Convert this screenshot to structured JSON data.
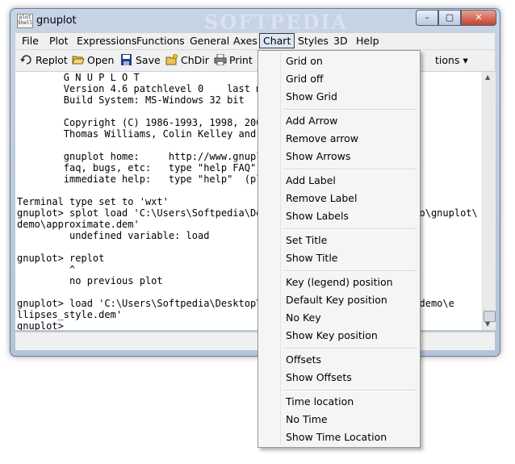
{
  "window": {
    "title": "gnuplot",
    "app_icon_text": "plot Shell",
    "watermark": "SOFTPEDIA",
    "buttons": {
      "minimize": "–",
      "maximize": "▢",
      "close": "✕"
    }
  },
  "menubar": [
    "File",
    "Plot",
    "Expressions",
    "Functions",
    "General",
    "Axes",
    "Chart",
    "Styles",
    "3D",
    "Help"
  ],
  "toolbar": {
    "replot": "Replot",
    "open": "Open",
    "save": "Save",
    "chdir": "ChDir",
    "print": "Print",
    "options_partial": "tions"
  },
  "console_lines": [
    "        G N U P L O T",
    "        Version 4.6 patchlevel 0    last mo",
    "        Build System: MS-Windows 32 bit",
    "",
    "        Copyright (C) 1986-1993, 1998, 2004",
    "        Thomas Williams, Colin Kelley and m",
    "",
    "        gnuplot home:     http://www.gnuplo",
    "        faq, bugs, etc:   type \"help FAQ\"",
    "        immediate help:   type \"help\"  (plo",
    "",
    "Terminal type set to 'wxt'",
    "gnuplot> splot load 'C:\\Users\\Softpedia\\Des                          o\\gnuplot\\",
    "demo\\approximate.dem'",
    "         undefined variable: load",
    "",
    "gnuplot> replot",
    "         ^",
    "         no previous plot",
    "",
    "gnuplot> load 'C:\\Users\\Softpedia\\Desktop\\X                       ot\\demo\\e",
    "llipses_style.dem'",
    "gnuplot>"
  ],
  "chart_menu": {
    "grid_on": "Grid on",
    "grid_off": "Grid off",
    "show_grid": "Show Grid",
    "add_arrow": "Add Arrow",
    "remove_arrow": "Remove arrow",
    "show_arrows": "Show Arrows",
    "add_label": "Add Label",
    "remove_label": "Remove Label",
    "show_labels": "Show Labels",
    "set_title": "Set Title",
    "show_title": "Show Title",
    "key_position": "Key (legend) position",
    "default_key_position": "Default Key position",
    "no_key": "No Key",
    "show_key_position": "Show Key position",
    "offsets": "Offsets",
    "show_offsets": "Show Offsets",
    "time_location": "Time location",
    "no_time": "No Time",
    "show_time_location": "Show Time Location"
  }
}
